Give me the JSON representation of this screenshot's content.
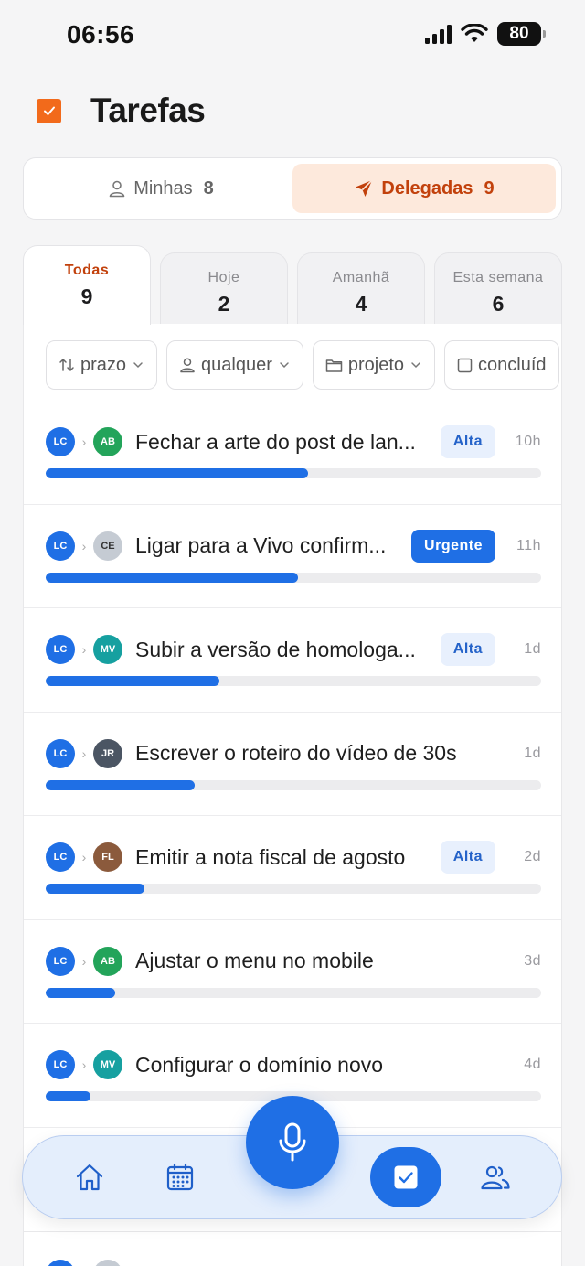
{
  "status_bar": {
    "time": "06:56",
    "battery": "80"
  },
  "header": {
    "title": "Tarefas",
    "icon": "checkbox-checked-icon",
    "accent": "#f26a1b"
  },
  "segments": [
    {
      "label": "Minhas",
      "count": "8",
      "icon": "user-icon",
      "active": false
    },
    {
      "label": "Delegadas",
      "count": "9",
      "icon": "send-icon",
      "active": true
    }
  ],
  "tabs": [
    {
      "label": "Todas",
      "count": "9",
      "active": true
    },
    {
      "label": "Hoje",
      "count": "2",
      "active": false
    },
    {
      "label": "Amanhã",
      "count": "4",
      "active": false
    },
    {
      "label": "Esta semana",
      "count": "6",
      "active": false
    }
  ],
  "filters": [
    {
      "label": "prazo",
      "icon": "sort-arrows-icon"
    },
    {
      "label": "qualquer",
      "icon": "user-icon"
    },
    {
      "label": "projeto",
      "icon": "folder-icon"
    },
    {
      "label": "concluíd",
      "icon": "checkbox-empty-icon"
    }
  ],
  "tasks": [
    {
      "from": "LC",
      "to": "AB",
      "to_color": "#23a45a",
      "title": "Fechar a arte do post de lan...",
      "badge": "Alta",
      "badge_type": "alta",
      "time": "10h",
      "progress": 0.53
    },
    {
      "from": "LC",
      "to": "CE",
      "to_color": "#c5cbd3",
      "title": "Ligar para a Vivo confirm...",
      "badge": "Urgente",
      "badge_type": "urgente",
      "time": "11h",
      "progress": 0.51
    },
    {
      "from": "LC",
      "to": "MV",
      "to_color": "#16a0a0",
      "title": "Subir a versão de homologa...",
      "badge": "Alta",
      "badge_type": "alta",
      "time": "1d",
      "progress": 0.35
    },
    {
      "from": "LC",
      "to": "JR",
      "to_color": "#4b5563",
      "title": "Escrever o roteiro do vídeo de 30s",
      "badge": "",
      "badge_type": "",
      "time": "1d",
      "progress": 0.3
    },
    {
      "from": "LC",
      "to": "FL",
      "to_color": "#8b5a3c",
      "title": "Emitir a nota fiscal de agosto",
      "badge": "Alta",
      "badge_type": "alta",
      "time": "2d",
      "progress": 0.2
    },
    {
      "from": "LC",
      "to": "AB",
      "to_color": "#23a45a",
      "title": "Ajustar o menu no mobile",
      "badge": "",
      "badge_type": "",
      "time": "3d",
      "progress": 0.14
    },
    {
      "from": "LC",
      "to": "MV",
      "to_color": "#16a0a0",
      "title": "Configurar o domínio novo",
      "badge": "",
      "badge_type": "",
      "time": "4d",
      "progress": 0.09
    }
  ],
  "colors": {
    "primary": "#1f6fe5",
    "accent_orange": "#c2410c",
    "avatar_lc": "#1f6fe5"
  },
  "bottom_nav": [
    {
      "name": "home",
      "icon": "home-icon",
      "active": false
    },
    {
      "name": "calendar",
      "icon": "calendar-icon",
      "active": false
    },
    {
      "name": "mic",
      "icon": "microphone-icon",
      "active": false
    },
    {
      "name": "tasks",
      "icon": "checkbox-checked-icon",
      "active": true
    },
    {
      "name": "people",
      "icon": "people-icon",
      "active": false
    }
  ]
}
